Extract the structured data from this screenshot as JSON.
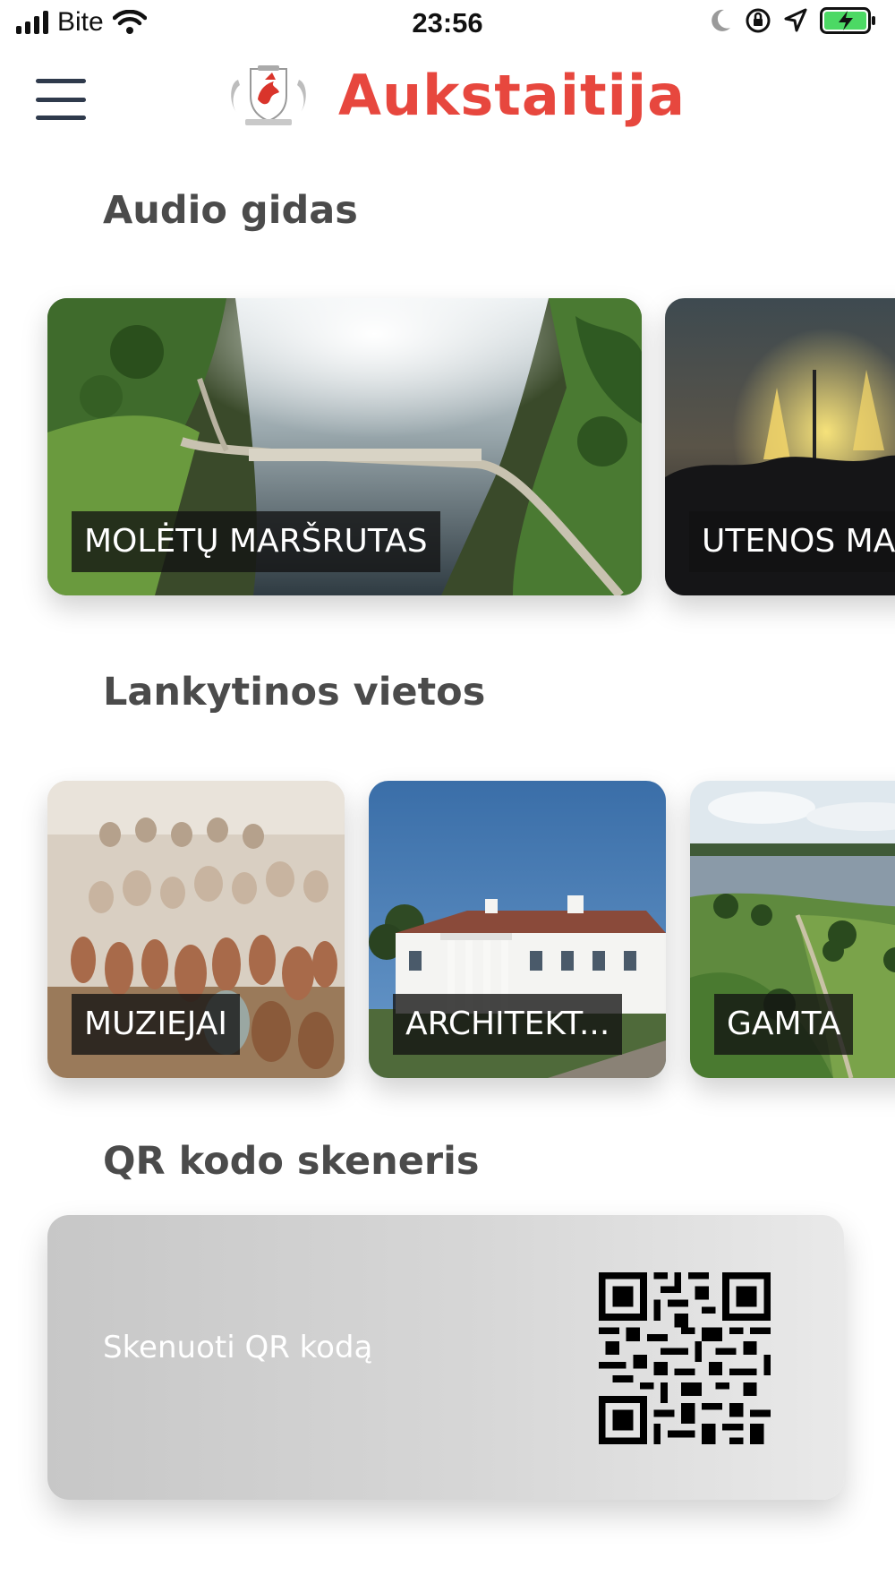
{
  "status_bar": {
    "carrier": "Bite",
    "time": "23:56"
  },
  "header": {
    "title": "Aukstaitija",
    "brand_color": "#e7473e"
  },
  "sections": {
    "audio": {
      "title": "Audio gidas",
      "cards": [
        {
          "label": "MOLĖTŲ MARŠRUTAS",
          "image": "aerial lake bridge photo"
        },
        {
          "label": "UTENOS MA",
          "image": "night fountain photo"
        }
      ]
    },
    "places": {
      "title": "Lankytinos vietos",
      "cards": [
        {
          "label": "MUZIEJAI",
          "image": "pottery museum photo"
        },
        {
          "label": "ARCHITEKT...",
          "image": "white manor house photo"
        },
        {
          "label": "GAMTA",
          "image": "hills and lake nature photo"
        }
      ]
    },
    "qr": {
      "title": "QR kodo skeneris",
      "button_label": "Skenuoti QR kodą"
    }
  },
  "icons": {
    "menu": "hamburger-menu-icon",
    "logo": "coat-of-arms-logo",
    "qr": "qr-code-icon"
  }
}
